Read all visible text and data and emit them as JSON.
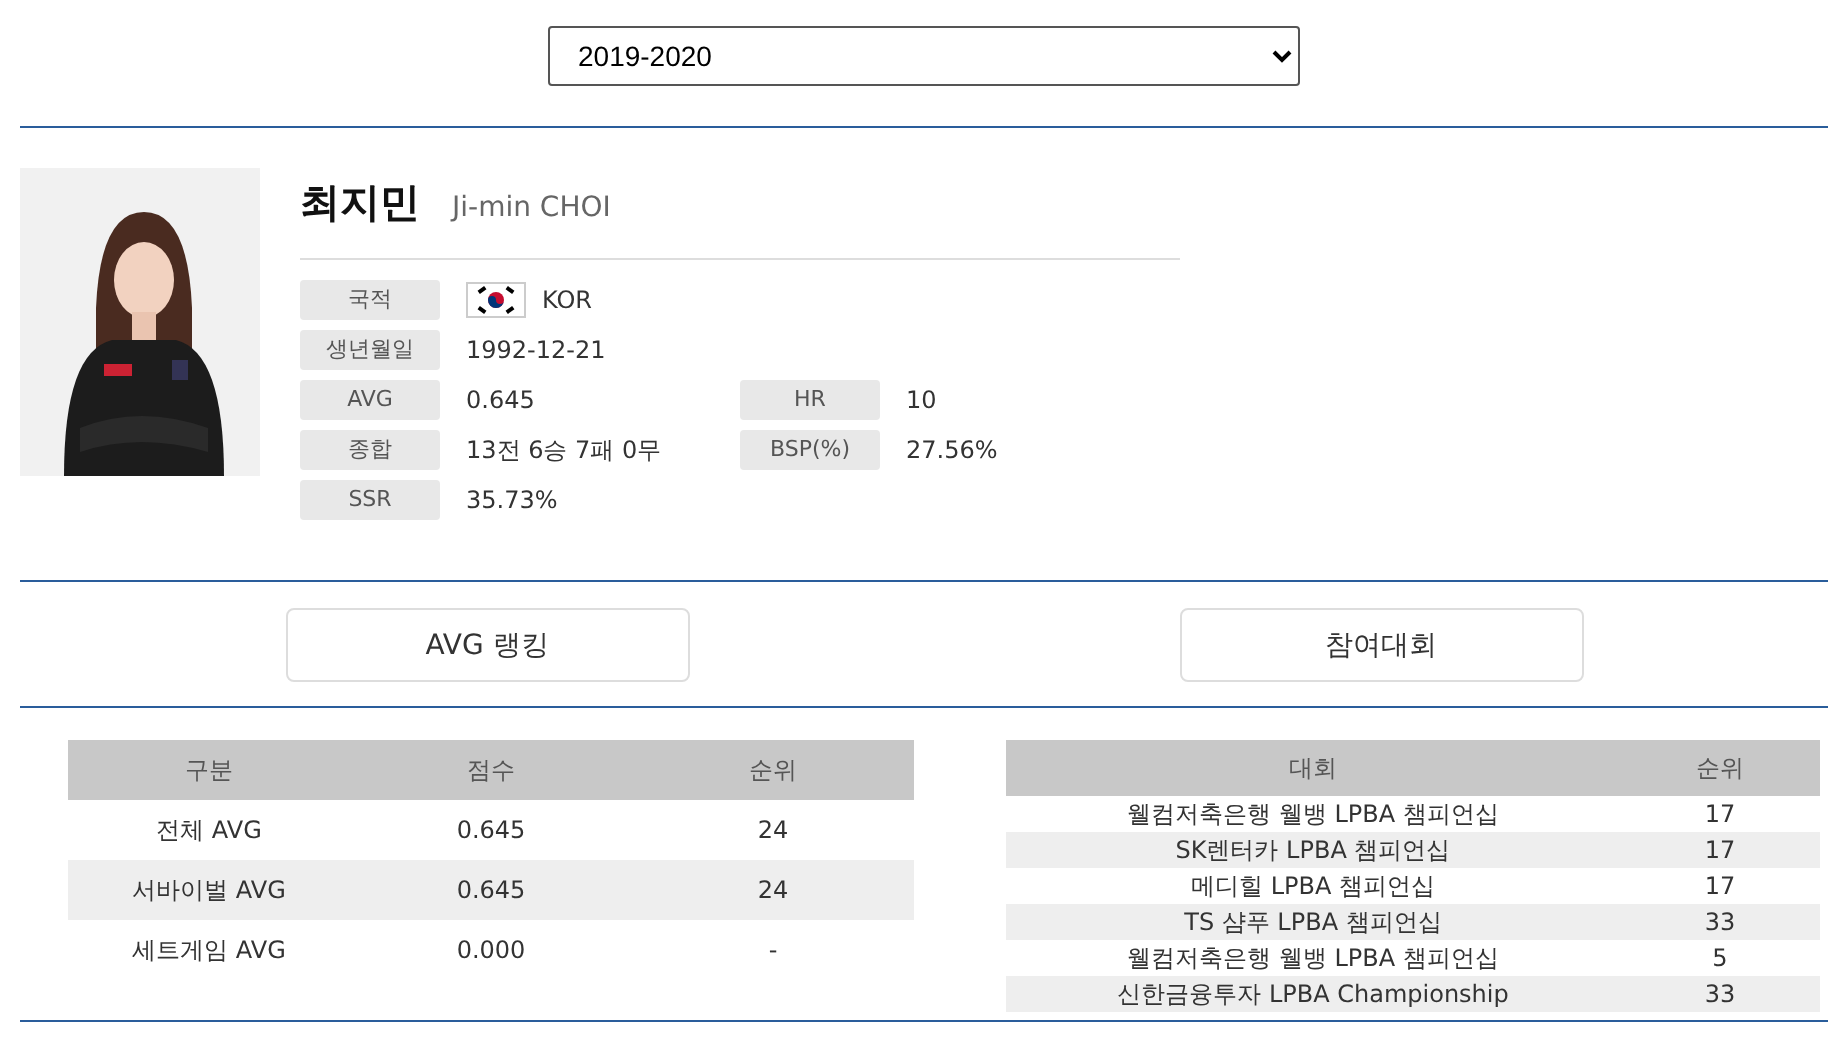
{
  "season_select": {
    "value": "2019-2020"
  },
  "player": {
    "name_ko": "최지민",
    "name_en": "Ji-min CHOI",
    "info": [
      {
        "label": "국적",
        "value": "KOR",
        "kind": "flag"
      },
      {
        "label": "생년월일",
        "value": "1992-12-21",
        "kind": "text"
      },
      {
        "label": "AVG",
        "value": "0.645",
        "kind": "text",
        "extra": {
          "label": "HR",
          "value": "10"
        }
      },
      {
        "label": "종합",
        "value": "13전 6승 7패 0무",
        "kind": "text",
        "extra": {
          "label": "BSP(%)",
          "value": "27.56%"
        }
      },
      {
        "label": "SSR",
        "value": "35.73%",
        "kind": "text"
      }
    ]
  },
  "buttons": [
    "AVG 랭킹",
    "참여대회"
  ],
  "avg_table": {
    "columns": [
      "구분",
      "점수",
      "순위"
    ],
    "rows": [
      [
        "전체 AVG",
        "0.645",
        "24"
      ],
      [
        "서바이벌 AVG",
        "0.645",
        "24"
      ],
      [
        "세트게임 AVG",
        "0.000",
        "-"
      ]
    ]
  },
  "tournament_table": {
    "columns": [
      "대회",
      "순위"
    ],
    "rows": [
      [
        "웰컴저축은행 웰뱅 LPBA 챔피언십",
        "17"
      ],
      [
        "SK렌터카 LPBA 챔피언십",
        "17"
      ],
      [
        "메디힐 LPBA 챔피언십",
        "17"
      ],
      [
        "TS 샴푸 LPBA 챔피언십",
        "33"
      ],
      [
        "웰컴저축은행 웰뱅 LPBA 챔피언십",
        "5"
      ],
      [
        "신한금융투자 LPBA Championship",
        "33"
      ]
    ]
  }
}
